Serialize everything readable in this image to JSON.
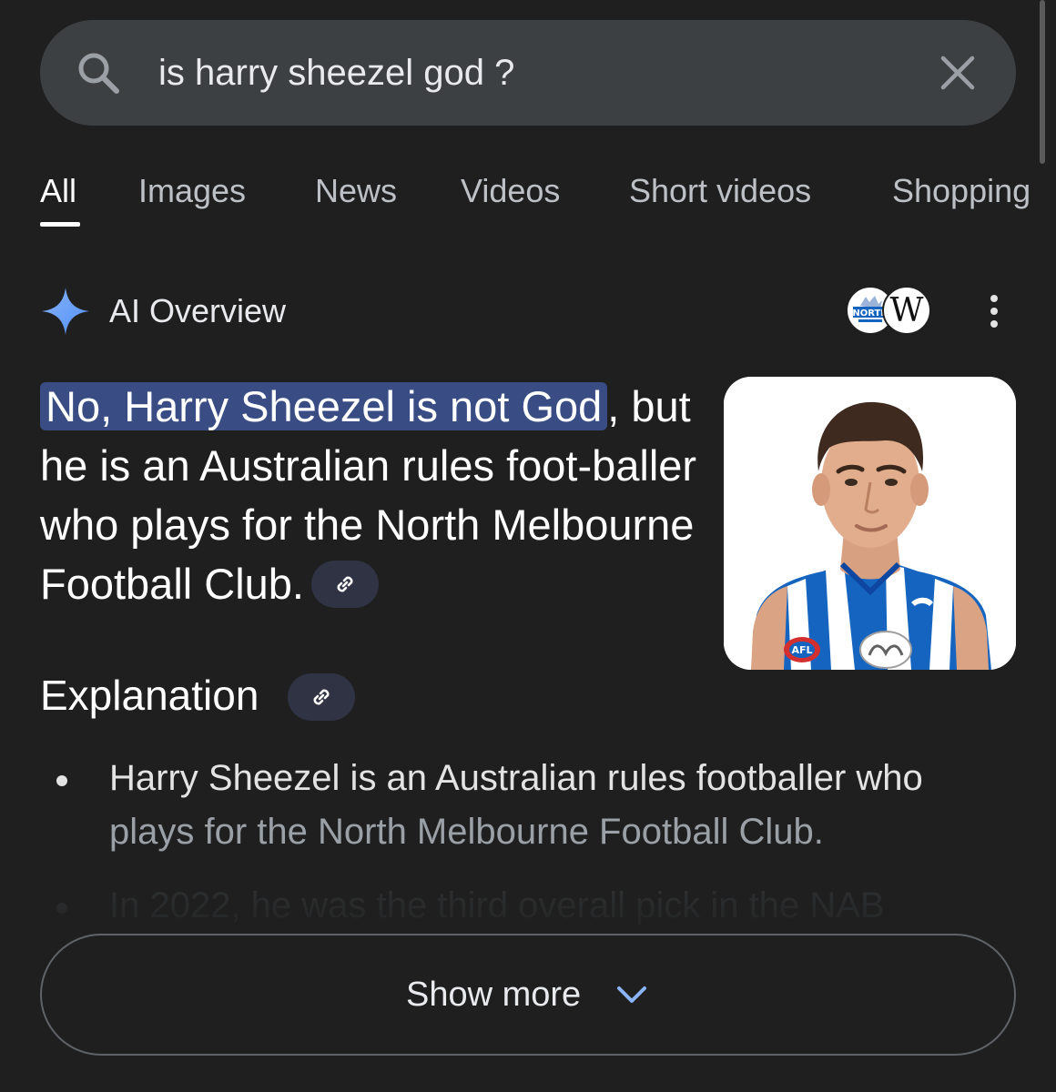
{
  "search": {
    "query": "is harry sheezel god ?"
  },
  "tabs": [
    {
      "label": "All",
      "active": true
    },
    {
      "label": "Images"
    },
    {
      "label": "News"
    },
    {
      "label": "Videos"
    },
    {
      "label": "Short videos"
    },
    {
      "label": "Shopping"
    }
  ],
  "ai_overview": {
    "title": "AI Overview",
    "sources": [
      {
        "name": "North Melbourne",
        "label": "NORTH",
        "icon": "north-melbourne-logo"
      },
      {
        "name": "Wikipedia",
        "label": "W",
        "icon": "wikipedia-logo"
      }
    ],
    "answer_highlight": "No, Harry Sheezel is not God",
    "answer_rest": ", but he is an Australian rules foot-baller who plays for the North Melbourne Football Club.",
    "explanation_title": "Explanation",
    "bullets": [
      {
        "line1": "Harry Sheezel is an Australian rules footballer who",
        "line2": "plays for the North Melbourne Football Club."
      },
      {
        "line1": "In 2022, he was the third overall pick in the NAB"
      }
    ],
    "show_more_label": "Show more",
    "photo_badges": {
      "league": "AFL"
    }
  },
  "colors": {
    "background": "#1f1f1f",
    "searchbar": "#3c4043",
    "highlight": "#394d84",
    "accent_blue": "#8ab4f8",
    "jersey_blue": "#1565c0"
  }
}
